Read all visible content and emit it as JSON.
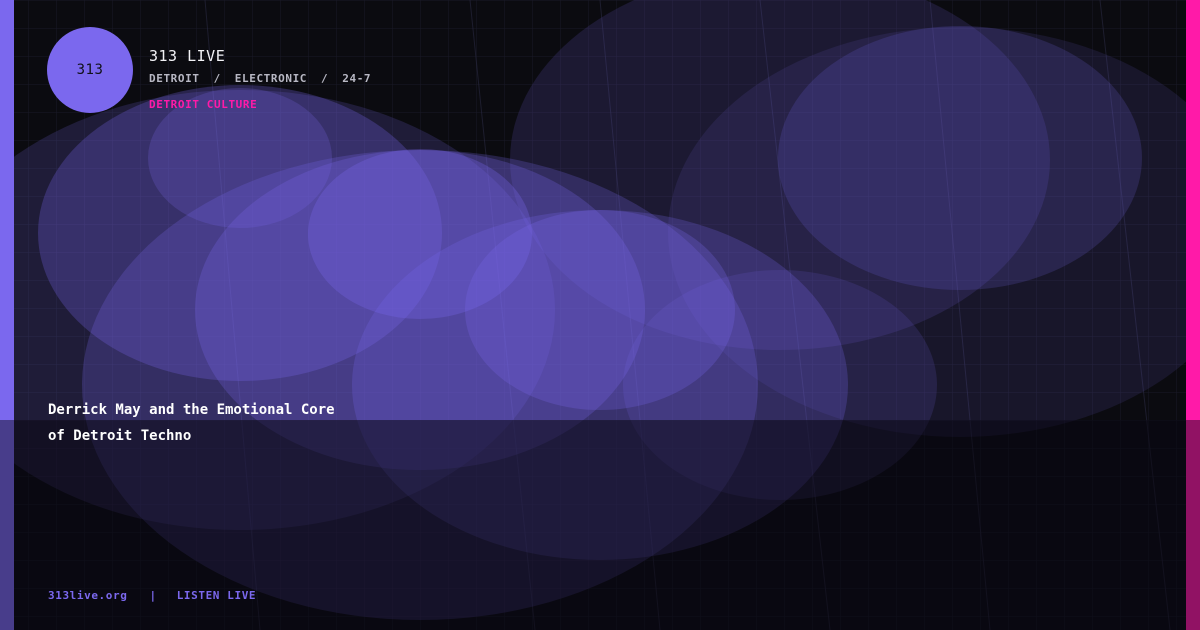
{
  "brand": {
    "logo_text": "313",
    "name": "313 LIVE",
    "tags": [
      "DETROIT",
      "ELECTRONIC",
      "24-7"
    ],
    "tag_separator": "/",
    "category": "DETROIT CULTURE"
  },
  "article": {
    "headline_line1": "Derrick May and the Emotional Core",
    "headline_line2": "of Detroit Techno"
  },
  "footer": {
    "site": "313live.org",
    "divider": "|",
    "cta": "LISTEN LIVE"
  },
  "colors": {
    "background": "#0b0b10",
    "accent_purple": "#7b68ee",
    "accent_pink": "#ff1aa8",
    "text_primary": "#ffffff",
    "text_muted": "#b8b8c4"
  }
}
